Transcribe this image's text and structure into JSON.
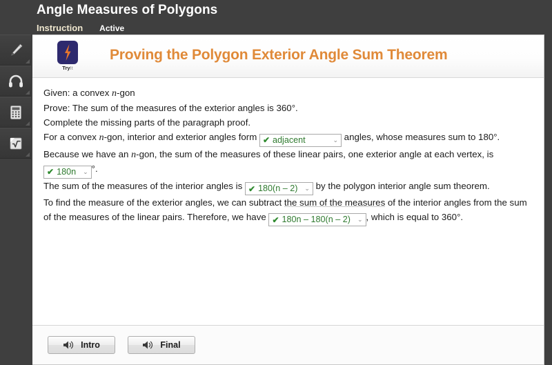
{
  "header": {
    "title": "Angle Measures of Polygons",
    "tabs": [
      {
        "label": "Instruction",
        "state": "active"
      },
      {
        "label": "Active",
        "state": "inactive"
      }
    ]
  },
  "toolbar": {
    "tools": [
      {
        "name": "highlighter-icon",
        "label": "Highlighter"
      },
      {
        "name": "headphones-icon",
        "label": "Audio"
      },
      {
        "name": "calculator-icon",
        "label": "Calculator"
      },
      {
        "name": "math-tool-icon",
        "label": "Math Tool"
      }
    ]
  },
  "banner": {
    "badge_primary": "Try",
    "badge_secondary": "It",
    "title": "Proving the Polygon Exterior Angle Sum Theorem",
    "title_color": "#e08a39",
    "badge_color": "#2e2a6e",
    "bolt_color": "#e8762c"
  },
  "lesson": {
    "given_label": "Given: a convex ",
    "given_var": "n",
    "given_tail": "-gon",
    "prove": "Prove: The sum of the measures of the exterior angles is 360°.",
    "instruction": "Complete the missing parts of the paragraph proof.",
    "p1_a": "For a convex ",
    "p1_var": "n",
    "p1_b": "-gon, interior and exterior angles form ",
    "p1_c": " angles, whose measures sum to 180°.",
    "p2_a": "Because we have an ",
    "p2_var": "n",
    "p2_b": "-gon, the sum of the measures of these linear pairs, one exterior angle at each vertex, is ",
    "p2_c": "°.",
    "p3_a": "The sum of the measures of the interior angles is ",
    "p3_b": " by the polygon interior angle sum theorem.",
    "p4_a": "To find the measure of the exterior angles, we can subtract ",
    "p4_highlight": "the sum of the measures",
    "p4_b": " of the interior angles from the sum of the measures of the linear pairs. Therefore, we have ",
    "p4_c": ", which is equal to 360°."
  },
  "answers": {
    "check_glyph": "✔",
    "chevron_glyph": "⌄",
    "a1": "adjacent",
    "a2": "180n",
    "a3": "180(n – 2)",
    "a4": "180n – 180(n – 2)",
    "correct_color": "#2f7a2f"
  },
  "footer": {
    "buttons": [
      {
        "label": "Intro",
        "icon": "speaker-icon"
      },
      {
        "label": "Final",
        "icon": "speaker-icon"
      }
    ]
  }
}
